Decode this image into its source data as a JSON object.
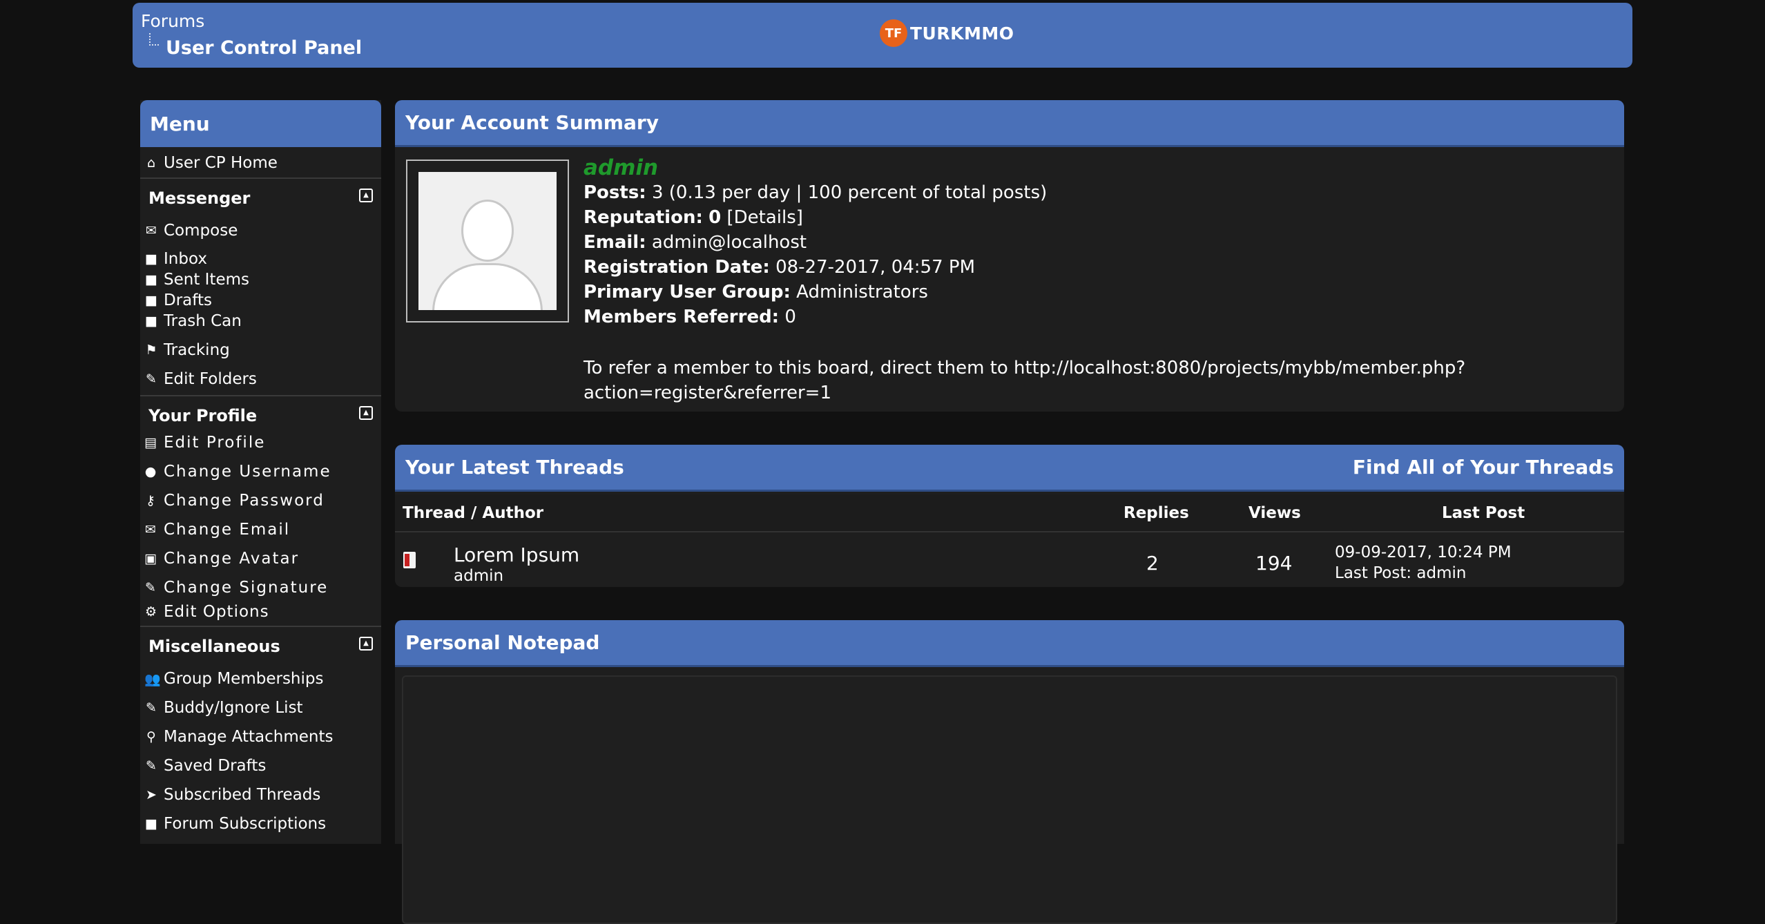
{
  "header": {
    "breadcrumb_root": "Forums",
    "breadcrumb_current": "User Control Panel",
    "logo_mark": "TF",
    "logo_text": "TURKMMO"
  },
  "sidebar": {
    "title": "Menu",
    "home": "User CP Home",
    "messenger": {
      "title": "Messenger",
      "compose": "Compose",
      "inbox": "Inbox",
      "sent": "Sent Items",
      "drafts": "Drafts",
      "trash": "Trash Can",
      "tracking": "Tracking",
      "edit_folders": "Edit Folders"
    },
    "profile": {
      "title": "Your Profile",
      "edit_profile": "Edit Profile",
      "change_username": "Change Username",
      "change_password": "Change Password",
      "change_email": "Change Email",
      "change_avatar": "Change Avatar",
      "change_signature": "Change Signature",
      "edit_options": "Edit Options"
    },
    "misc": {
      "title": "Miscellaneous",
      "group_memberships": "Group Memberships",
      "buddy_list": "Buddy/Ignore List",
      "attachments": "Manage Attachments",
      "saved_drafts": "Saved Drafts",
      "subscribed_threads": "Subscribed Threads",
      "forum_subscriptions": "Forum Subscriptions"
    }
  },
  "summary": {
    "title": "Your Account Summary",
    "username": "admin",
    "posts_label": "Posts:",
    "posts_value": "3 (0.13 per day | 100 percent of total posts)",
    "reputation_label": "Reputation:",
    "reputation_value": "0",
    "reputation_details": "[Details]",
    "email_label": "Email:",
    "email_value": "admin@localhost",
    "regdate_label": "Registration Date:",
    "regdate_value": "08-27-2017, 04:57 PM",
    "group_label": "Primary User Group:",
    "group_value": "Administrators",
    "referred_label": "Members Referred:",
    "referred_value": "0",
    "refer_line1": "To refer a member to this board, direct them to http://localhost:8080/projects/mybb/member.php?",
    "refer_line2": "action=register&referrer=1"
  },
  "threads": {
    "title": "Your Latest Threads",
    "find_all": "Find All of Your Threads",
    "columns": {
      "thread": "Thread / Author",
      "replies": "Replies",
      "views": "Views",
      "last_post": "Last Post"
    },
    "rows": [
      {
        "title": "Lorem Ipsum",
        "author": "admin",
        "replies": "2",
        "views": "194",
        "last_date": "09-09-2017, 10:24 PM",
        "last_by": "Last Post: admin"
      }
    ]
  },
  "notepad": {
    "title": "Personal Notepad"
  },
  "colors": {
    "accent": "#4a70b8",
    "background": "#111111",
    "panel": "#1e1e1e",
    "username": "#1f9a2c"
  },
  "icons": {
    "home": "home-icon",
    "mail": "envelope-icon",
    "folder": "folder-icon",
    "flag": "flag-icon",
    "pencil": "pencil-icon",
    "card": "id-card-icon",
    "user": "user-icon",
    "key": "key-icon",
    "image": "image-icon",
    "gear": "gear-icon",
    "group": "users-icon",
    "clip": "paperclip-icon",
    "send": "paper-plane-icon",
    "collapse": "collapse-icon"
  }
}
